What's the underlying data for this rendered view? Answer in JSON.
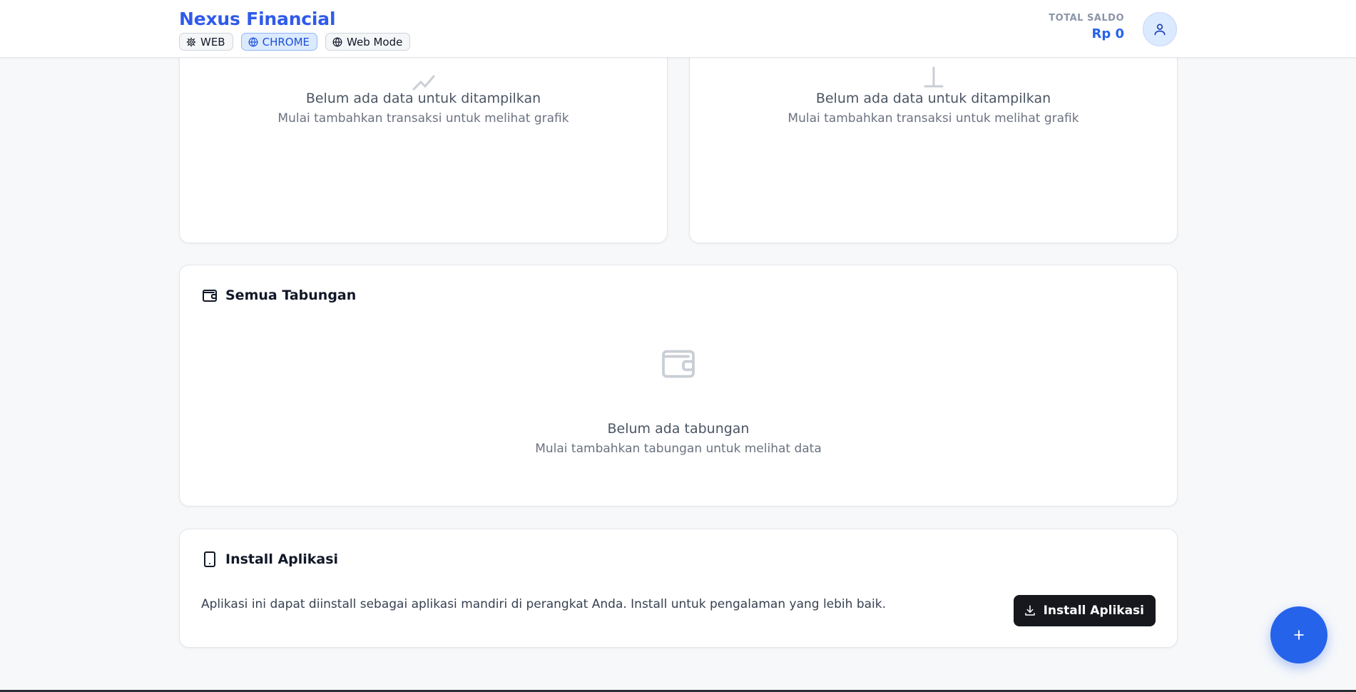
{
  "header": {
    "brand": "Nexus Financial",
    "chips": [
      {
        "label": "WEB",
        "icon": "gear-icon"
      },
      {
        "label": "CHROME",
        "icon": "globe-icon"
      },
      {
        "label": "Web Mode",
        "icon": "globe-icon"
      }
    ],
    "saldo_label": "TOTAL SALDO",
    "saldo_value": "Rp 0"
  },
  "charts": {
    "left": {
      "empty_title": "Belum ada data untuk ditampilkan",
      "empty_sub": "Mulai tambahkan transaksi untuk melihat grafik"
    },
    "right": {
      "empty_title": "Belum ada data untuk ditampilkan",
      "empty_sub": "Mulai tambahkan transaksi untuk melihat grafik"
    }
  },
  "savings": {
    "title": "Semua Tabungan",
    "empty_title": "Belum ada tabungan",
    "empty_sub": "Mulai tambahkan tabungan untuk melihat data"
  },
  "install": {
    "title": "Install Aplikasi",
    "description": "Aplikasi ini dapat diinstall sebagai aplikasi mandiri di perangkat Anda. Install untuk pengalaman yang lebih baik.",
    "button_label": "Install Aplikasi"
  },
  "colors": {
    "brand": "#2f5bea",
    "accent": "#2563eb",
    "button_dark": "#16181d",
    "muted_icon": "#c9ced6"
  }
}
